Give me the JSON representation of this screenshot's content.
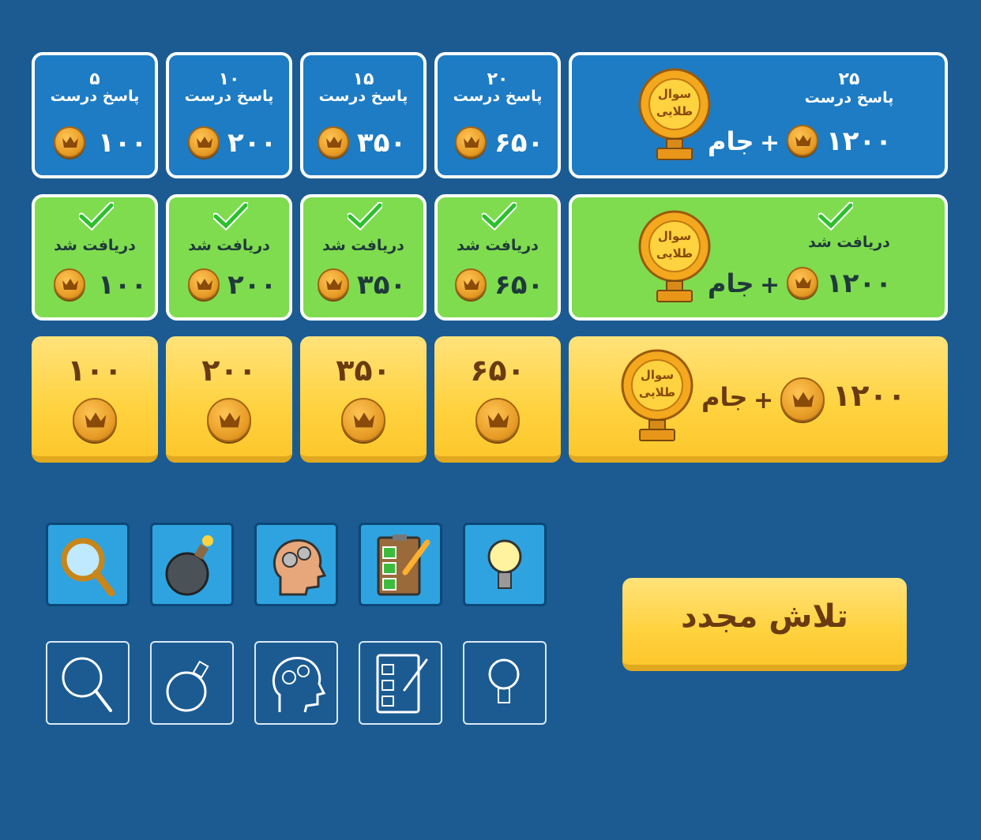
{
  "rewards_pending": [
    {
      "count": "۵",
      "caption": "پاسخ درست",
      "coins": "۱۰۰"
    },
    {
      "count": "۱۰",
      "caption": "پاسخ درست",
      "coins": "۲۰۰"
    },
    {
      "count": "۱۵",
      "caption": "پاسخ درست",
      "coins": "۳۵۰"
    },
    {
      "count": "۲۰",
      "caption": "پاسخ درست",
      "coins": "۶۵۰"
    }
  ],
  "reward_pending_big": {
    "count": "۲۵",
    "caption": "پاسخ درست",
    "coins": "۱۲۰۰",
    "plus": "+",
    "trophy_text": "جام",
    "trophy_label_1": "سوال",
    "trophy_label_2": "طلایی"
  },
  "rewards_received": [
    {
      "caption": "دریافت شد",
      "coins": "۱۰۰"
    },
    {
      "caption": "دریافت شد",
      "coins": "۲۰۰"
    },
    {
      "caption": "دریافت شد",
      "coins": "۳۵۰"
    },
    {
      "caption": "دریافت شد",
      "coins": "۶۵۰"
    }
  ],
  "reward_received_big": {
    "caption": "دریافت شد",
    "coins": "۱۲۰۰",
    "plus": "+",
    "trophy_text": "جام",
    "trophy_label_1": "سوال",
    "trophy_label_2": "طلایی"
  },
  "rewards_gold": [
    {
      "coins": "۱۰۰"
    },
    {
      "coins": "۲۰۰"
    },
    {
      "coins": "۳۵۰"
    },
    {
      "coins": "۶۵۰"
    }
  ],
  "reward_gold_big": {
    "coins": "۱۲۰۰",
    "plus": "+",
    "trophy_text": "جام",
    "trophy_label_1": "سوال",
    "trophy_label_2": "طلایی"
  },
  "helpers_color": [
    "magnifier-icon",
    "bomb-icon",
    "brain-gears-icon",
    "checklist-icon",
    "lightbulb-icon"
  ],
  "helpers_outline": [
    "magnifier-icon",
    "bomb-icon",
    "brain-gears-icon",
    "checklist-icon",
    "lightbulb-icon"
  ],
  "retry_label": "تلاش مجدد",
  "colors": {
    "background": "#1b5b92",
    "blue_card": "#1d7cc4",
    "green_card": "#7fdc4f",
    "gold_card": "#ffd23f",
    "retry_text": "#6a3b10"
  }
}
